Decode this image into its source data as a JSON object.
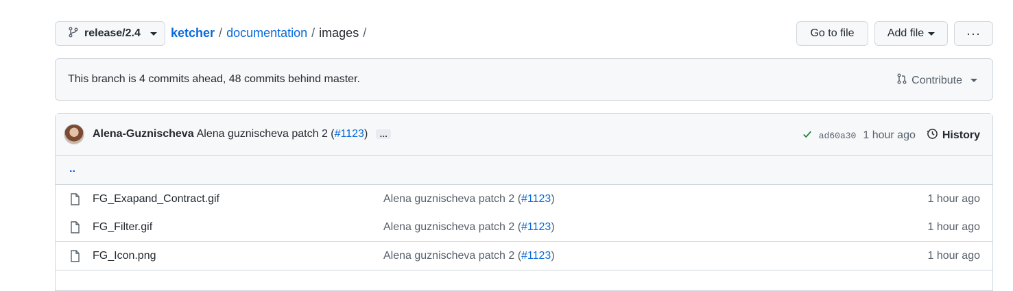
{
  "branch": {
    "name": "release/2.4"
  },
  "breadcrumb": {
    "repo": "ketcher",
    "sep1": "/",
    "dir": "documentation",
    "sep2": "/",
    "current": "images",
    "sep3": "/"
  },
  "toolbar": {
    "go_to_file": "Go to file",
    "add_file": "Add file",
    "more": "···"
  },
  "branch_info": {
    "message": "This branch is 4 commits ahead, 48 commits behind master.",
    "contribute": "Contribute"
  },
  "latest_commit": {
    "author": "Alena-Guznischeva",
    "message": "Alena guznischeva patch 2 (",
    "pr": "#1123",
    "message_end": ")",
    "ellipsis": "…",
    "sha": "ad60a30",
    "age": "1 hour ago",
    "history": "History"
  },
  "parent_dir": "..",
  "files": [
    {
      "name": "FG_Exapand_Contract.gif",
      "msg": "Alena guznischeva patch 2 (",
      "pr": "#1123",
      "msg_end": ")",
      "age": "1 hour ago"
    },
    {
      "name": "FG_Filter.gif",
      "msg": "Alena guznischeva patch 2 (",
      "pr": "#1123",
      "msg_end": ")",
      "age": "1 hour ago"
    },
    {
      "name": "FG_Icon.png",
      "msg": "Alena guznischeva patch 2 (",
      "pr": "#1123",
      "msg_end": ")",
      "age": "1 hour ago"
    }
  ],
  "colors": {
    "link": "#0969da",
    "check": "#1a7f37",
    "border": "#d0d7de",
    "muted": "#57606a"
  },
  "icons": {
    "branch": "git-branch-icon",
    "contribute": "git-pull-request-icon",
    "history": "history-icon",
    "file": "file-icon",
    "check": "check-icon"
  }
}
